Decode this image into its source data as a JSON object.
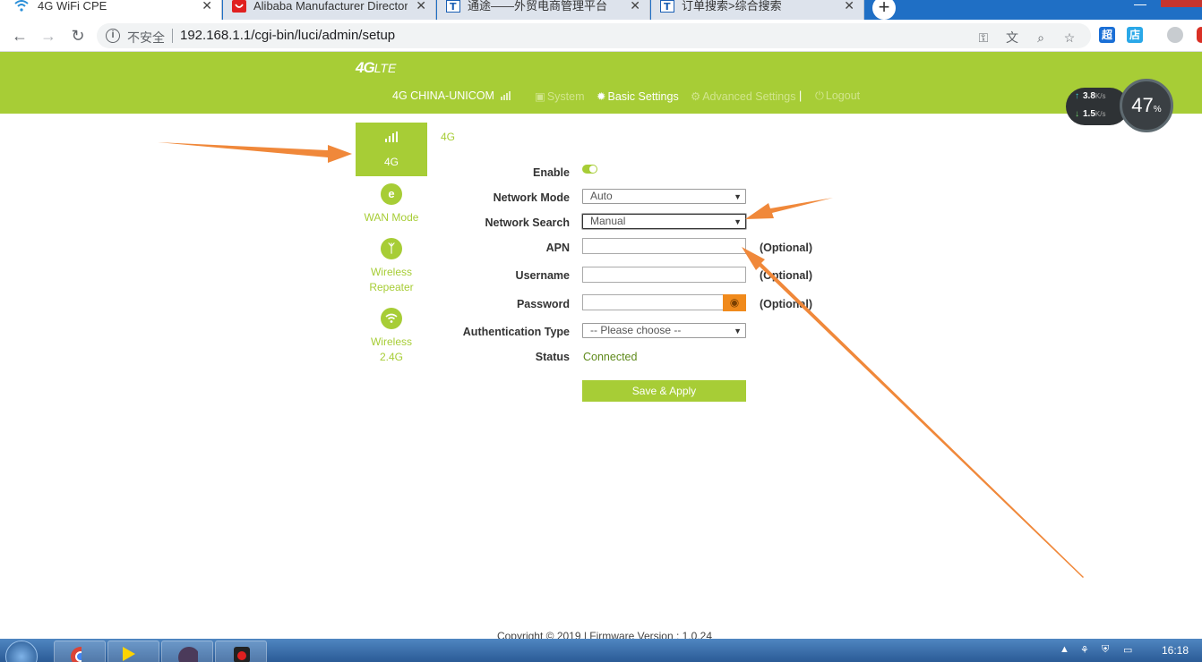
{
  "browser": {
    "tabs": [
      {
        "title": "4G WiFi CPE",
        "close": "✕"
      },
      {
        "title": "Alibaba Manufacturer Director",
        "close": "✕"
      },
      {
        "title": "通途——外贸电商管理平台",
        "close": "✕"
      },
      {
        "title": "订单搜索>综合搜索",
        "close": "✕"
      }
    ],
    "new_tab": "+",
    "security_label": "不安全",
    "url": "192.168.1.1/cgi-bin/luci/admin/setup",
    "extensions": [
      "超",
      "店"
    ]
  },
  "header": {
    "logo_main": "4G",
    "logo_sub": "LTE",
    "carrier": "4G  CHINA-UNICOM",
    "nav": [
      {
        "label": "System",
        "icon": "monitor-icon",
        "active": false
      },
      {
        "label": "Basic Settings",
        "icon": "gear-icon",
        "active": true
      },
      {
        "label": "Advanced Settings",
        "icon": "gears-icon",
        "active": false
      },
      {
        "label": "Logout",
        "icon": "power-icon",
        "active": false
      }
    ],
    "separator": "|"
  },
  "speed_widget": {
    "upload": "3.8",
    "download": "1.5",
    "unit": "K/s",
    "percent": "47",
    "percent_sign": "%"
  },
  "side_menu": {
    "items": [
      {
        "label": "4G",
        "icon": "signal-icon",
        "active": true
      },
      {
        "label": "WAN Mode",
        "icon": "globe-icon",
        "active": false
      },
      {
        "label": "Wireless\nRepeater",
        "icon": "antenna-icon",
        "active": false
      },
      {
        "label": "Wireless\n2.4G",
        "icon": "wifi-icon",
        "active": false
      }
    ]
  },
  "section_tag": "4G",
  "form": {
    "enable_label": "Enable",
    "network_mode_label": "Network Mode",
    "network_mode_value": "Auto",
    "network_search_label": "Network Search",
    "network_search_value": "Manual",
    "apn_label": "APN",
    "username_label": "Username",
    "password_label": "Password",
    "auth_label": "Authentication Type",
    "auth_value": "-- Please choose --",
    "status_label": "Status",
    "status_value": "Connected",
    "optional_hint": "(Optional)",
    "apply_label": "Save & Apply"
  },
  "footer": "Copyright © 2019  |  Firmware Version : 1.0.24",
  "taskbar": {
    "time": "16:18"
  },
  "colors": {
    "brand_green": "#a7cd36",
    "annotation_orange": "#f0883a",
    "eye_button": "#f08a1c"
  }
}
